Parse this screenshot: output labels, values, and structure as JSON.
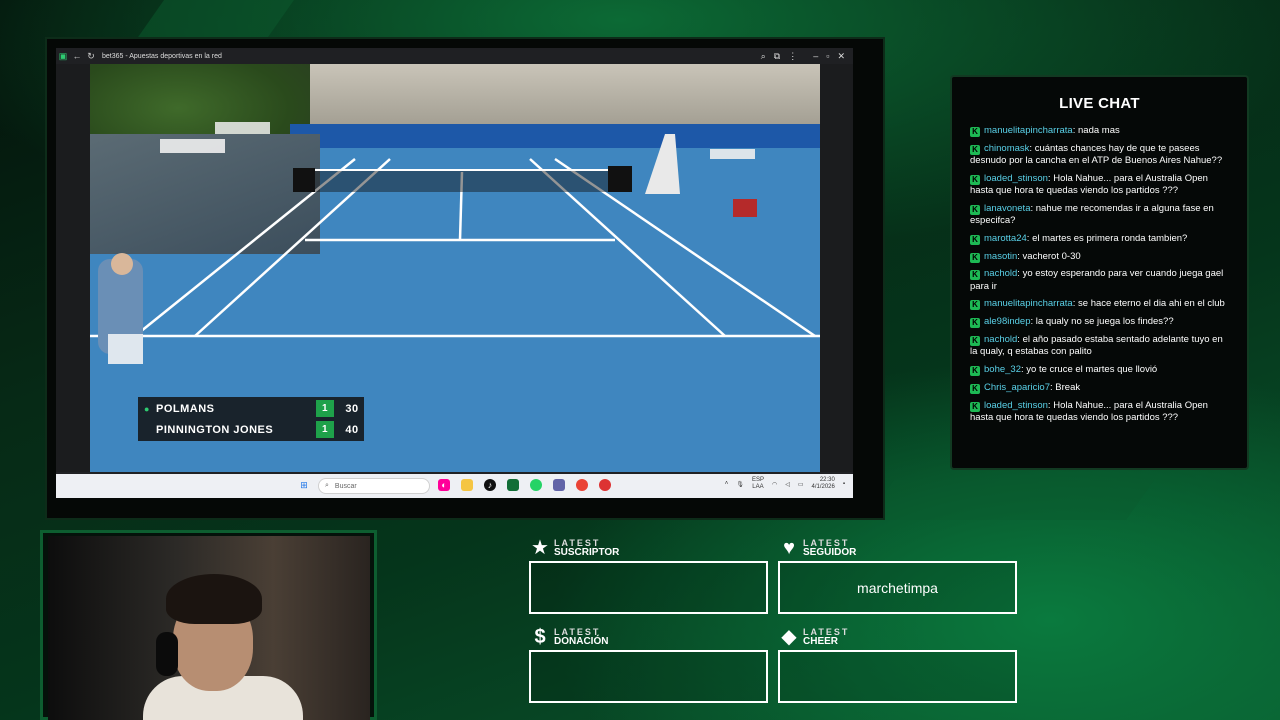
{
  "browser": {
    "tab_title": "bet365 - Apuestas deportivas en la red"
  },
  "scoreboard": {
    "players": [
      {
        "name": "POLMANS",
        "sets": "1",
        "points": "30",
        "serving": true
      },
      {
        "name": "PINNINGTON JONES",
        "sets": "1",
        "points": "40",
        "serving": false
      }
    ]
  },
  "taskbar": {
    "search_placeholder": "Buscar",
    "lang": "ESP",
    "lang_sub": "LAA",
    "time": "22:30",
    "date": "4/1/2026"
  },
  "chat": {
    "title": "LIVE CHAT",
    "messages": [
      {
        "user": "manuelitapincharrata",
        "text": "nada mas"
      },
      {
        "user": "chinomask",
        "text": "cuántas chances hay de que te pasees desnudo por la cancha en el ATP de Buenos Aires Nahue??"
      },
      {
        "user": "loaded_stinson",
        "text": "Hola Nahue... para el Australia Open hasta que hora te quedas viendo los partidos ???"
      },
      {
        "user": "lanavoneta",
        "text": "nahue me recomendas ir a alguna fase en especifca?"
      },
      {
        "user": "marotta24",
        "text": "el martes es primera ronda tambien?"
      },
      {
        "user": "masotin",
        "text": "vacherot 0-30"
      },
      {
        "user": "nachold",
        "text": "yo estoy esperando para ver cuando juega gael para ir"
      },
      {
        "user": "manuelitapincharrata",
        "text": "se hace eterno el dia ahi en el club"
      },
      {
        "user": "ale98indep",
        "text": "la qualy no se juega los findes??"
      },
      {
        "user": "nachold",
        "text": "el año pasado estaba sentado adelante tuyo en la qualy, q estabas con palito"
      },
      {
        "user": "bohe_32",
        "text": "yo te cruce el martes que llovió"
      },
      {
        "user": "Chris_aparicio7",
        "text": "Break"
      },
      {
        "user": "loaded_stinson",
        "text": "Hola Nahue... para el Australia Open hasta que hora te quedas viendo los partidos ???"
      }
    ]
  },
  "widgets": {
    "suscriptor": {
      "top": "LATEST",
      "bottom": "SUSCRIPTOR",
      "value": ""
    },
    "seguidor": {
      "top": "LATEST",
      "bottom": "SEGUIDOR",
      "value": "marchetimpa"
    },
    "donacion": {
      "top": "LATEST",
      "bottom": "DONACIÓN",
      "value": ""
    },
    "cheer": {
      "top": "LATEST",
      "bottom": "CHEER",
      "value": ""
    }
  },
  "icons": {
    "star": "star-icon",
    "heart": "heart-icon",
    "dollar": "dollar-icon",
    "diamond": "diamond-icon"
  },
  "colors": {
    "accent": "#1db954",
    "chat_user": "#5ad1e8"
  }
}
